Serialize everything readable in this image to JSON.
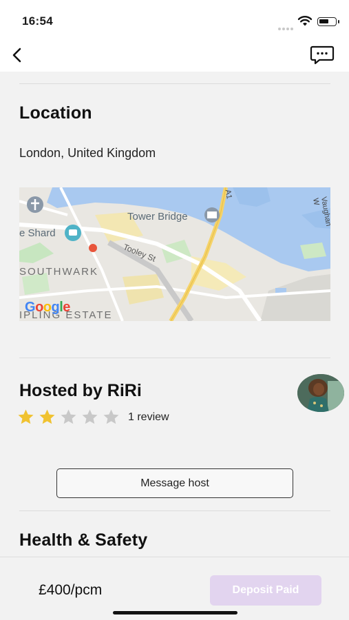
{
  "status_bar": {
    "time": "16:54"
  },
  "nav": {
    "back_icon": "chevron-left-icon",
    "chat_icon": "chat-bubble-icon"
  },
  "location": {
    "title": "Location",
    "address": "London, United Kingdom",
    "map": {
      "labels": {
        "tower_bridge": "Tower Bridge",
        "shard": "e Shard",
        "southwark": "SOUTHWARK",
        "tooley": "Tooley St",
        "estate": "IPLING ESTATE",
        "road_a1": "A1",
        "vaughan": "Vaughan W",
        "google": "Google"
      },
      "colors": {
        "water": "#a9c9f0",
        "park": "#c7e6c0",
        "land": "#e9e7e2",
        "road_major": "#f5d36a"
      }
    }
  },
  "host": {
    "title": "Hosted by RiRi",
    "rating": 2,
    "rating_max": 5,
    "reviews_label": "1 review",
    "message_button": "Message host",
    "star_color_filled": "#f0c230",
    "star_color_empty": "#c8c8c8"
  },
  "health": {
    "title": "Health & Safety"
  },
  "footer": {
    "price": "£400/pcm",
    "deposit_button": "Deposit Paid",
    "deposit_button_color": "#e2d4ef"
  }
}
